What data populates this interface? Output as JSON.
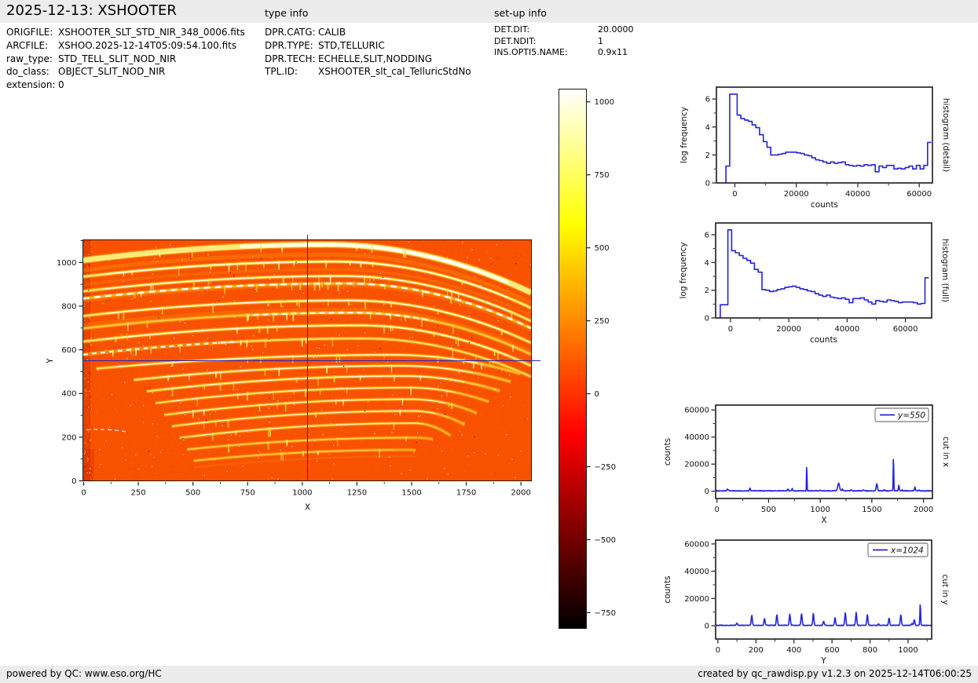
{
  "header": {
    "title": "2025-12-13: XSHOOTER",
    "type_info_label": "type info",
    "setup_info_label": "set-up info"
  },
  "file_info": {
    "rows": [
      {
        "label": "ORIGFILE:",
        "value": "XSHOOTER_SLT_STD_NIR_348_0006.fits"
      },
      {
        "label": "ARCFILE:",
        "value": "XSHOO.2025-12-14T05:09:54.100.fits"
      },
      {
        "label": "raw_type:",
        "value": "STD_TELL_SLIT_NOD_NIR"
      },
      {
        "label": "do_class:",
        "value": "OBJECT_SLIT_NOD_NIR"
      },
      {
        "label": "extension:",
        "value": "0"
      }
    ]
  },
  "type_info": {
    "rows": [
      {
        "label": "DPR.CATG:",
        "value": "CALIB"
      },
      {
        "label": "DPR.TYPE:",
        "value": "STD,TELLURIC"
      },
      {
        "label": "DPR.TECH:",
        "value": "ECHELLE,SLIT,NODDING"
      },
      {
        "label": "TPL.ID:",
        "value": "XSHOOTER_slt_cal_TelluricStdNo"
      }
    ]
  },
  "setup_info": {
    "rows": [
      {
        "label": "DET.DIT:",
        "value": "20.0000"
      },
      {
        "label": "DET.NDIT:",
        "value": "1"
      },
      {
        "label": "INS.OPTI5.NAME:",
        "value": "0.9x11"
      }
    ]
  },
  "footer": {
    "left": "powered by QC: www.eso.org/HC",
    "right": "created by qc_rawdisp.py v1.2.3 on 2025-12-14T06:00:25"
  },
  "colors": {
    "header_bg": "#ececec",
    "line_blue": "#2222e0",
    "crosshair_blue": "#2323c0",
    "frame_black": "#1a1a1a",
    "image_background": "#f85200",
    "order_glow": "#ffb400",
    "order_bright": "#ffee7a",
    "order_core": "#ffffff",
    "hot_gradient": [
      [
        0,
        "#ffffff"
      ],
      [
        12,
        "#ffff85"
      ],
      [
        25,
        "#ffff00"
      ],
      [
        45,
        "#ff7c00"
      ],
      [
        64,
        "#ff0000"
      ],
      [
        82,
        "#7e0000"
      ],
      [
        100,
        "#000000"
      ]
    ]
  },
  "chart_data": [
    {
      "type": "heatmap",
      "name": "raw frame echelle image",
      "xlabel": "X",
      "ylabel": "Y",
      "xlim": [
        0,
        2048
      ],
      "ylim": [
        0,
        1100
      ],
      "xticks": [
        0,
        250,
        500,
        750,
        1000,
        1250,
        1500,
        1750,
        2000
      ],
      "yticks": [
        0,
        200,
        400,
        600,
        800,
        1000
      ],
      "crosshair": {
        "x": 1024,
        "y": 550
      },
      "colormap": "hot",
      "background_counts": 150,
      "orders": [
        [
          0,
          1008,
          1120,
          1080,
          2048,
          860,
          22,
          1.0,
          "band"
        ],
        [
          0,
          933,
          1150,
          1002,
          2048,
          790,
          8,
          0.95,
          "solid"
        ],
        [
          0,
          866,
          1180,
          936,
          2048,
          730,
          7,
          0.9,
          "solid"
        ],
        [
          0,
          833,
          1200,
          902,
          2048,
          697,
          6,
          1.0,
          "dash"
        ],
        [
          0,
          753,
          1220,
          824,
          2048,
          630,
          7,
          0.9,
          "solid"
        ],
        [
          0,
          696,
          1240,
          768,
          2048,
          577,
          7,
          0.9,
          "dashM"
        ],
        [
          0,
          636,
          1260,
          710,
          2048,
          525,
          7,
          0.88,
          "solid"
        ],
        [
          0,
          576,
          1280,
          650,
          2048,
          475,
          6,
          0.85,
          "dashL"
        ],
        [
          60,
          512,
          1420,
          575,
          2000,
          488,
          6,
          0.85,
          "solid"
        ],
        [
          230,
          460,
          1450,
          525,
          1955,
          452,
          6,
          0.85,
          "solid"
        ],
        [
          290,
          408,
          1470,
          478,
          1905,
          410,
          6,
          0.82,
          "solid"
        ],
        [
          330,
          354,
          1490,
          425,
          1855,
          360,
          5,
          0.8,
          "solid"
        ],
        [
          370,
          300,
          1500,
          372,
          1800,
          308,
          5,
          0.8,
          "solid"
        ],
        [
          405,
          248,
          1510,
          318,
          1745,
          255,
          5,
          0.78,
          "solid"
        ],
        [
          440,
          195,
          1515,
          262,
          1680,
          205,
          5,
          0.75,
          "solid"
        ],
        [
          475,
          142,
          1520,
          196,
          1600,
          188,
          4,
          0.7,
          "solid"
        ],
        [
          505,
          90,
          1480,
          140,
          1520,
          138,
          4,
          0.62,
          "solid"
        ]
      ],
      "scratch": {
        "x0": 15,
        "y0": 232,
        "cx": 110,
        "cy": 238,
        "x1": 205,
        "y1": 222
      }
    },
    {
      "type": "colorbar",
      "name": "colorbar",
      "colormap": "hot",
      "vmin": -800,
      "vmax": 1045,
      "ticks": [
        1000,
        750,
        500,
        250,
        0,
        -250,
        -500,
        -750
      ]
    },
    {
      "type": "line",
      "name": "histogram (detail)",
      "xlabel": "counts",
      "ylabel": "log frequency",
      "side_label": "histogram (detail)",
      "xlim": [
        -6000,
        64300
      ],
      "ylim": [
        0,
        6.85
      ],
      "xticks": [
        0,
        20000,
        40000,
        60000
      ],
      "yticks": [
        0,
        2,
        4,
        6
      ],
      "bins": {
        "x_start": -2900,
        "bin_width": 1215,
        "values": [
          1.2,
          6.35,
          6.35,
          4.85,
          4.6,
          4.5,
          4.4,
          4.15,
          3.95,
          3.45,
          2.95,
          2.55,
          2.0,
          2.0,
          2.05,
          2.1,
          2.2,
          2.2,
          2.2,
          2.15,
          2.1,
          2.0,
          1.95,
          1.8,
          1.65,
          1.6,
          1.5,
          1.4,
          1.5,
          1.4,
          1.45,
          1.5,
          1.3,
          1.25,
          1.2,
          1.25,
          1.2,
          1.3,
          1.25,
          1.3,
          0.8,
          1.2,
          1.1,
          1.25,
          1.25,
          1.0,
          1.05,
          1.0,
          1.1,
          1.2,
          1.0,
          1.25,
          1.0,
          1.25,
          2.9
        ]
      }
    },
    {
      "type": "line",
      "name": "histogram (full)",
      "xlabel": "counts",
      "ylabel": "log frequency",
      "side_label": "histogram (full)",
      "xlim": [
        -5100,
        69000
      ],
      "ylim": [
        0,
        6.85
      ],
      "xticks": [
        0,
        20000,
        40000,
        60000
      ],
      "yticks": [
        0,
        2,
        4,
        6
      ],
      "bins": {
        "x_start": -3500,
        "bin_width": 1300,
        "values": [
          0.95,
          0.95,
          6.35,
          4.85,
          4.7,
          4.5,
          4.3,
          4.15,
          3.95,
          3.5,
          3.3,
          2.05,
          2.0,
          1.9,
          1.95,
          2.05,
          2.1,
          2.2,
          2.25,
          2.3,
          2.2,
          2.1,
          2.05,
          1.95,
          1.9,
          1.75,
          1.65,
          1.55,
          1.65,
          1.5,
          1.45,
          1.4,
          1.45,
          1.35,
          1.1,
          1.4,
          1.4,
          1.45,
          1.3,
          1.15,
          1.0,
          1.25,
          1.2,
          1.15,
          1.3,
          1.25,
          1.2,
          1.1,
          1.15,
          1.15,
          1.15,
          1.1,
          1.0,
          1.05,
          2.9
        ]
      }
    },
    {
      "type": "line",
      "name": "cut in x",
      "xlabel": "X",
      "ylabel": "counts",
      "side_label": "cut in x",
      "legend": "y=550",
      "xlim": [
        -13,
        2087
      ],
      "ylim": [
        -5400,
        63600
      ],
      "xticks": [
        0,
        500,
        1000,
        1500,
        2000
      ],
      "yticks": [
        0,
        20000,
        40000,
        60000
      ],
      "profile": {
        "baseline": 260,
        "noise": 260,
        "peaks": [
          [
            100,
            1300,
            4
          ],
          [
            112,
            700,
            3
          ],
          [
            320,
            1900,
            4
          ],
          [
            688,
            1300,
            5
          ],
          [
            728,
            1800,
            4
          ],
          [
            870,
            17300,
            2.5
          ],
          [
            1000,
            500,
            5
          ],
          [
            1178,
            5600,
            9
          ],
          [
            1215,
            1400,
            4
          ],
          [
            1300,
            700,
            5
          ],
          [
            1420,
            650,
            5
          ],
          [
            1548,
            5200,
            6
          ],
          [
            1620,
            700,
            4
          ],
          [
            1710,
            23200,
            2.6
          ],
          [
            1762,
            4100,
            4
          ],
          [
            1795,
            900,
            3
          ],
          [
            1918,
            2900,
            4
          ],
          [
            1960,
            600,
            4
          ]
        ]
      }
    },
    {
      "type": "line",
      "name": "cut in y",
      "xlabel": "Y",
      "ylabel": "counts",
      "side_label": "cut in y",
      "legend": "x=1024",
      "xlim": [
        -12,
        1124
      ],
      "ylim": [
        -9800,
        62800
      ],
      "xticks": [
        0,
        200,
        400,
        600,
        800,
        1000
      ],
      "yticks": [
        0,
        20000,
        40000,
        60000
      ],
      "profile": {
        "baseline": 240,
        "noise": 220,
        "peaks": [
          [
            100,
            1500,
            3
          ],
          [
            178,
            7300,
            3
          ],
          [
            245,
            4800,
            3
          ],
          [
            310,
            7600,
            3
          ],
          [
            378,
            8100,
            3
          ],
          [
            440,
            8400,
            3
          ],
          [
            502,
            8700,
            3
          ],
          [
            556,
            2900,
            3
          ],
          [
            616,
            5500,
            3
          ],
          [
            670,
            9100,
            3
          ],
          [
            727,
            9500,
            3
          ],
          [
            786,
            7700,
            3
          ],
          [
            845,
            900,
            3
          ],
          [
            900,
            5100,
            3
          ],
          [
            962,
            7500,
            3
          ],
          [
            1020,
            1400,
            3
          ],
          [
            1033,
            4100,
            3
          ],
          [
            1064,
            15100,
            2
          ]
        ]
      }
    }
  ]
}
